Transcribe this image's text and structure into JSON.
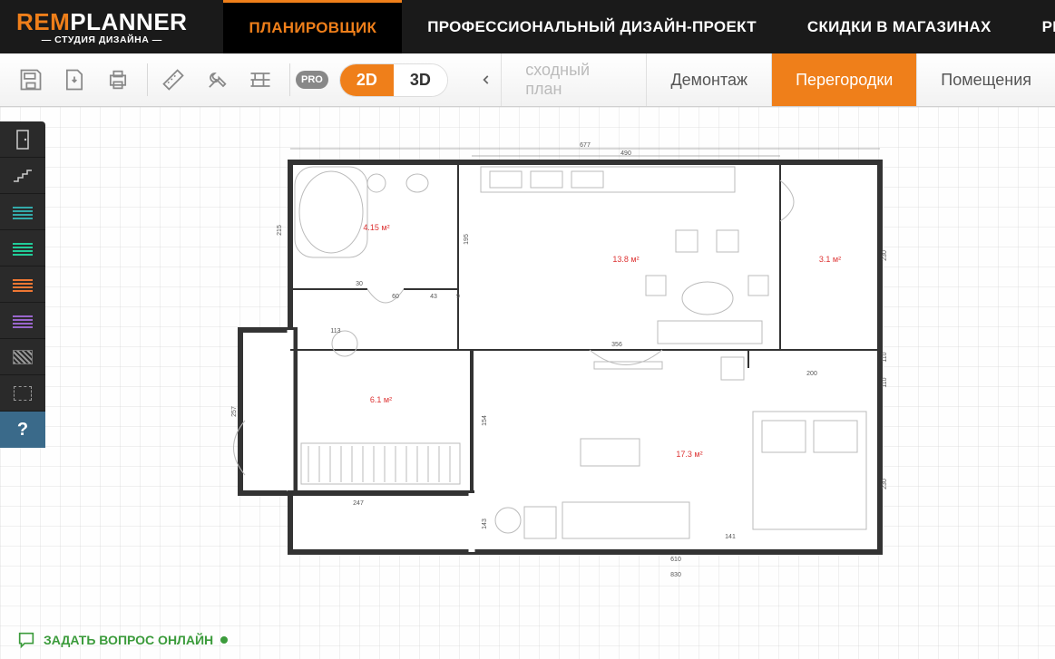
{
  "logo": {
    "rem": "REM",
    "planner": "PLANNER",
    "subtitle": "— СТУДИЯ ДИЗАЙНА —"
  },
  "nav": {
    "items": [
      "ПЛАНИРОВЩИК",
      "ПРОФЕССИОНАЛЬНЫЙ ДИЗАЙН-ПРОЕКТ",
      "СКИДКИ В МАГАЗИНАХ",
      "РЕМ"
    ],
    "active_index": 0
  },
  "toolbar": {
    "pro": "PRO",
    "view_2d": "2D",
    "view_3d": "3D",
    "active_view": "2D",
    "tabs": [
      "сходный план",
      "Демонтаж",
      "Перегородки",
      "Помещения"
    ],
    "active_tab_index": 2
  },
  "side_palette": {
    "help_label": "?"
  },
  "rooms": {
    "bathroom": "4.15 м²",
    "hall": "6.1 м²",
    "kitchen": "13.8 м²",
    "storage": "3.1 м²",
    "bedroom": "17.3 м²"
  },
  "dimensions": {
    "top_total": "677",
    "top_right": "490",
    "left_bathroom": "215",
    "left_hall": "257",
    "right_1": "230",
    "right_2": "110",
    "right_3": "110",
    "right_4": "230",
    "bottom_bedroom": "610",
    "bottom_total": "830",
    "bottom_hall": "247",
    "kitchen_inner": "356",
    "kitchen_left": "195",
    "bedroom_top_right": "200",
    "inner_30": "30",
    "inner_60": "60",
    "inner_43": "43",
    "inner_9": "9",
    "inner_113": "113",
    "inner_143": "143",
    "inner_154": "154",
    "inner_141": "141"
  },
  "bottom": {
    "chat_label": "ЗАДАТЬ ВОПРОС ОНЛАЙН"
  }
}
